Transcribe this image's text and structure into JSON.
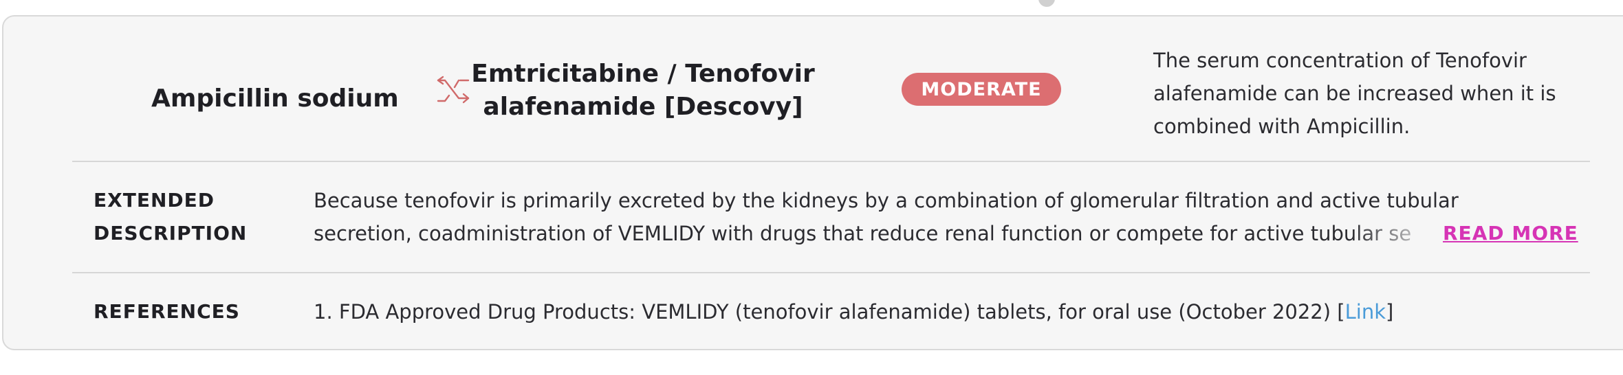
{
  "interaction": {
    "drug_a": "Ampicillin sodium",
    "drug_b_line1": "Emtricitabine / Tenofovir",
    "drug_b_line2": "alafenamide [Descovy]",
    "severity": "MODERATE",
    "summary_lines": [
      "The serum concentration of Tenofovir",
      "alafenamide can be increased when it is",
      "combined with Ampicillin."
    ]
  },
  "extended": {
    "label_line1": "EXTENDED",
    "label_line2": "DESCRIPTION",
    "text_line1": "Because tenofovir is primarily excreted by the kidneys by a combination of glomerular filtration and active tubular",
    "text_line2": "secretion, coadministration of VEMLIDY with drugs that reduce renal function or compete for active tubular se",
    "read_more_label": "READ MORE"
  },
  "references": {
    "label": "REFERENCES",
    "items": [
      {
        "text": "1. FDA Approved Drug Products: VEMLIDY (tenofovir alafenamide) tablets, for oral use (October 2022)",
        "link_label": "Link"
      }
    ]
  },
  "colors": {
    "severity_badge": "#dc6e71",
    "swap_icon": "#d06a6a",
    "read_more": "#d634b5",
    "link": "#4a9bd8",
    "card_background": "#f6f6f6"
  },
  "icons": {
    "swap": "swap-arrows-icon"
  }
}
